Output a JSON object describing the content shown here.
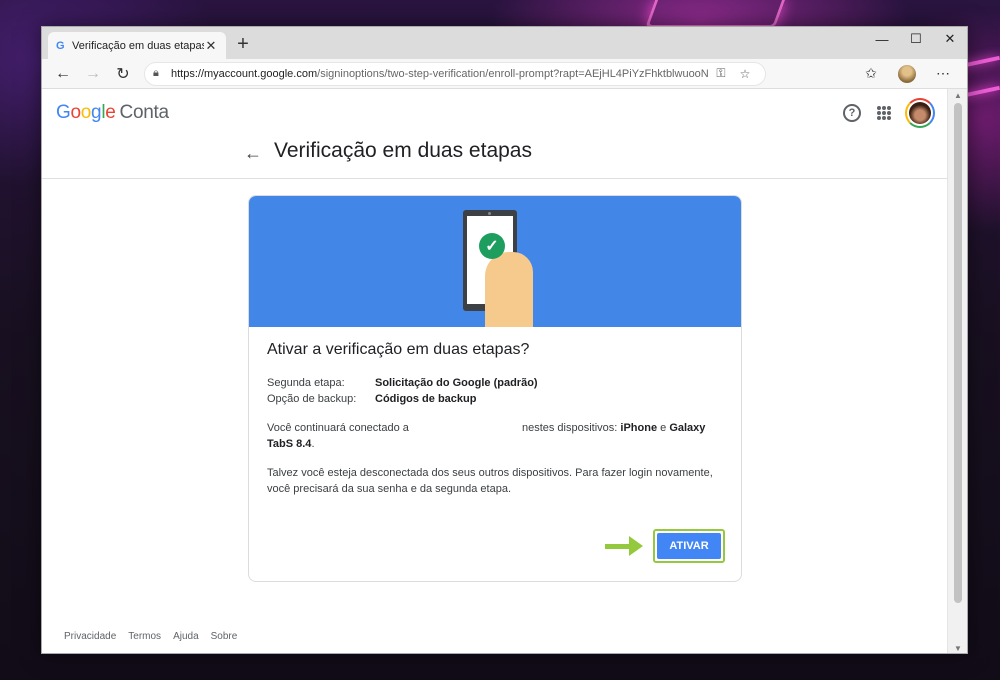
{
  "browser": {
    "tab_title": "Verificação em duas etapas",
    "tab_favicon": "G",
    "url_domain": "https://myaccount.google.com",
    "url_path": "/signinoptions/two-step-verification/enroll-prompt?rapt=AEjHL4PiYzFhktblwuooN..."
  },
  "header": {
    "logo_letters": [
      "G",
      "o",
      "o",
      "g",
      "l",
      "e"
    ],
    "logo_suffix": "Conta",
    "help_glyph": "?"
  },
  "page": {
    "title": "Verificação em duas etapas"
  },
  "card": {
    "title": "Ativar a verificação em duas etapas?",
    "rows": [
      {
        "label": "Segunda etapa:",
        "value": "Solicitação do Google (padrão)"
      },
      {
        "label": "Opção de backup:",
        "value": "Códigos de backup"
      }
    ],
    "connected_prefix": "Você continuará conectado a",
    "connected_middle": "nestes dispositivos:",
    "device1": "iPhone",
    "connector": "e",
    "device2": "Galaxy TabS 8.4",
    "warning": "Talvez você esteja desconectada dos seus outros dispositivos. Para fazer login novamente, você precisará da sua senha e da segunda etapa.",
    "button_label": "ATIVAR"
  },
  "footer": {
    "links": [
      "Privacidade",
      "Termos",
      "Ajuda",
      "Sobre"
    ]
  },
  "colors": {
    "accent": "#4285f4",
    "banner": "#4286e8",
    "highlight": "#95c93d"
  }
}
